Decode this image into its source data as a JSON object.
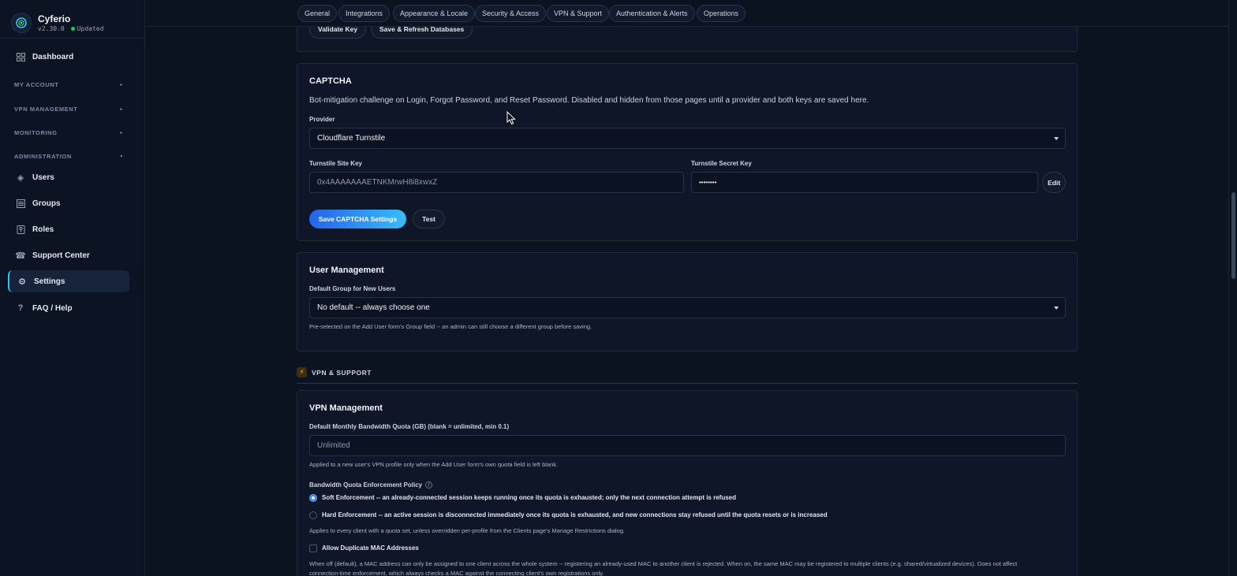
{
  "brand": {
    "name": "Cyferio",
    "version": "v2.30.0",
    "status": "Updated"
  },
  "sidebar": {
    "dashboard": "Dashboard",
    "sections": {
      "my_account": "MY ACCOUNT",
      "vpn_management": "VPN MANAGEMENT",
      "monitoring": "MONITORING",
      "administration": "ADMINISTRATION"
    },
    "items": {
      "users": "Users",
      "groups": "Groups",
      "roles": "Roles",
      "support_center": "Support Center",
      "settings": "Settings",
      "faq": "FAQ / Help"
    }
  },
  "tabs": [
    "General",
    "Integrations",
    "Appearance & Locale",
    "Security & Access",
    "VPN & Support",
    "Authentication & Alerts",
    "Operations"
  ],
  "prev_card": {
    "validate_key": "Validate Key",
    "save_refresh": "Save & Refresh Databases"
  },
  "captcha": {
    "title": "CAPTCHA",
    "description": "Bot-mitigation challenge on Login, Forgot Password, and Reset Password. Disabled and hidden from those pages until a provider and both keys are saved here.",
    "provider_label": "Provider",
    "provider_value": "Cloudflare Turnstile",
    "site_key_label": "Turnstile Site Key",
    "site_key_value": "0x4AAAAAAAETNKMrwH8i8xwxZ",
    "secret_key_label": "Turnstile Secret Key",
    "secret_key_value": "••••••••",
    "edit": "Edit",
    "save": "Save CAPTCHA Settings",
    "test": "Test"
  },
  "user_management": {
    "title": "User Management",
    "default_group_label": "Default Group for New Users",
    "default_group_value": "No default -- always choose one",
    "help": "Pre-selected on the Add User form's Group field -- an admin can still choose a different group before saving."
  },
  "section_vpn": {
    "label": "VPN & SUPPORT"
  },
  "vpn_management": {
    "title": "VPN Management",
    "quota_label": "Default Monthly Bandwidth Quota (GB) (blank = unlimited, min 0.1)",
    "quota_placeholder": "Unlimited",
    "quota_help": "Applied to a new user's VPN profile only when the Add User form's own quota field is left blank.",
    "policy_label": "Bandwidth Quota Enforcement Policy",
    "soft_name": "Soft Enforcement",
    "soft_desc": " -- an already-connected session keeps running once its quota is exhausted; only the next connection attempt is refused",
    "hard_name": "Hard Enforcement",
    "hard_desc": " -- an active session is disconnected immediately once its quota is exhausted, and new connections stay refused until the quota resets or is increased",
    "policy_help": "Applies to every client with a quota set, unless overridden per-profile from the Clients page's Manage Restrictions dialog.",
    "dup_mac_label": "Allow Duplicate MAC Addresses",
    "dup_mac_help_1": "When off (default), a MAC address can only be assigned to one client across the whole system -- registering an already-used MAC to another client is rejected. When on, the same MAC may be registered to multiple clients (e.g. shared/virtualized devices). Does not affect",
    "dup_mac_help_2": "connection-time enforcement, which always checks a MAC against the connecting client's own registrations only."
  },
  "colors": {
    "accent": "#38bdf8",
    "primary_button": "#2563eb",
    "background": "#0b1220",
    "card": "#0e1627"
  }
}
